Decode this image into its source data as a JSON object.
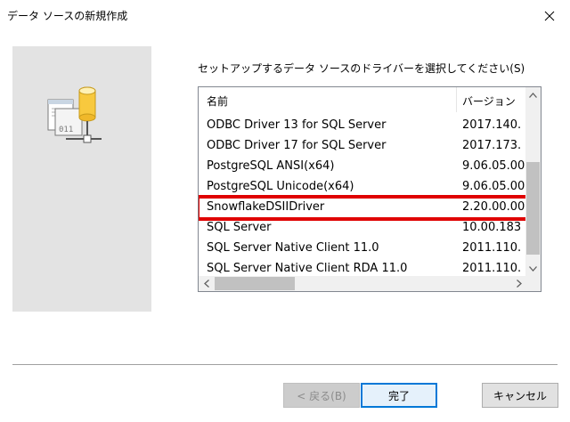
{
  "window": {
    "title": "データ ソースの新規作成"
  },
  "prompt": "セットアップするデータ ソースのドライバーを選択してください(S)",
  "list": {
    "columns": {
      "name": "名前",
      "version": "バージョン"
    },
    "rows": [
      {
        "name": "ODBC Driver 13 for SQL Server",
        "version": "2017.140."
      },
      {
        "name": "ODBC Driver 17 for SQL Server",
        "version": "2017.173."
      },
      {
        "name": "PostgreSQL ANSI(x64)",
        "version": "9.06.05.00"
      },
      {
        "name": "PostgreSQL Unicode(x64)",
        "version": "9.06.05.00"
      },
      {
        "name": "SnowflakeDSIIDriver",
        "version": "2.20.00.00"
      },
      {
        "name": "SQL Server",
        "version": "10.00.183"
      },
      {
        "name": "SQL Server Native Client 11.0",
        "version": "2011.110."
      },
      {
        "name": "SQL Server Native Client RDA 11.0",
        "version": "2011.110."
      }
    ],
    "selected_index": 4
  },
  "buttons": {
    "back": "< 戻る(B)",
    "finish": "完了",
    "cancel": "キャンセル"
  },
  "icon_image_text": "011"
}
